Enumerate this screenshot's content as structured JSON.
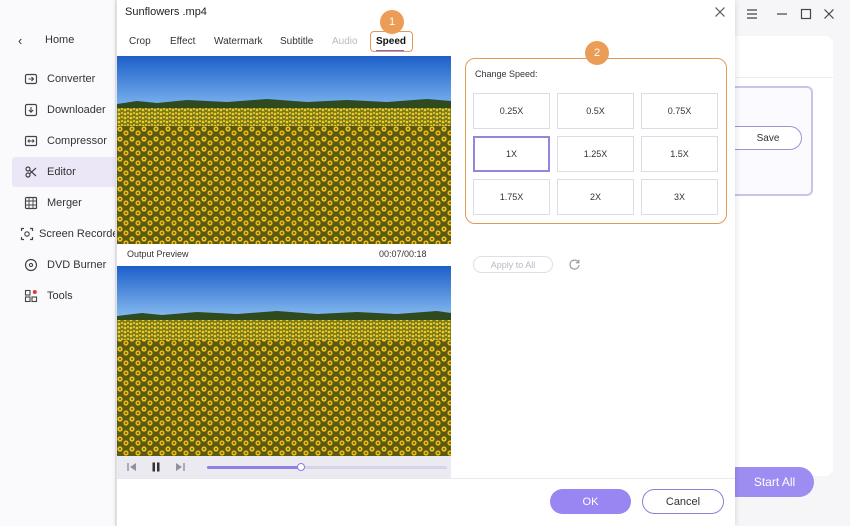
{
  "sidebar": {
    "home_label": "Home",
    "items": [
      {
        "label": "Converter",
        "icon": "converter-icon"
      },
      {
        "label": "Downloader",
        "icon": "downloader-icon"
      },
      {
        "label": "Compressor",
        "icon": "compressor-icon"
      },
      {
        "label": "Editor",
        "icon": "editor-scissors-icon",
        "active": true
      },
      {
        "label": "Merger",
        "icon": "merger-icon"
      },
      {
        "label": "Screen Recorder",
        "icon": "screen-recorder-icon"
      },
      {
        "label": "DVD Burner",
        "icon": "dvd-burner-icon"
      },
      {
        "label": "Tools",
        "icon": "tools-grid-icon"
      }
    ]
  },
  "dialog": {
    "title": "Sunflowers .mp4",
    "tabs": [
      {
        "label": "Crop"
      },
      {
        "label": "Effect"
      },
      {
        "label": "Watermark"
      },
      {
        "label": "Subtitle"
      },
      {
        "label": "Audio",
        "disabled": true
      },
      {
        "label": "Speed",
        "active": true
      }
    ],
    "markers": [
      "1",
      "2"
    ],
    "preview": {
      "output_label": "Output Preview",
      "time": "00:07/00:18",
      "progress": 0.39
    },
    "speed": {
      "label": "Change Speed:",
      "options": [
        "0.25X",
        "0.5X",
        "0.75X",
        "1X",
        "1.25X",
        "1.5X",
        "1.75X",
        "2X",
        "3X"
      ],
      "selected": "1X"
    },
    "apply_all_label": "Apply to All",
    "ok_label": "OK",
    "cancel_label": "Cancel"
  },
  "background_app": {
    "save_label": "Save",
    "start_all_label": "Start All"
  },
  "colors": {
    "accent": "#9a86f2",
    "highlight": "#e49a56",
    "marker": "#eb9c57"
  }
}
